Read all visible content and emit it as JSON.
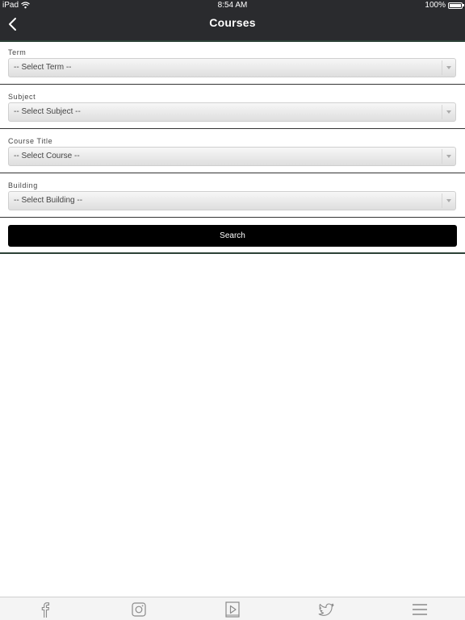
{
  "status_bar": {
    "carrier": "iPad",
    "time": "8:54 AM",
    "battery_percent": "100%"
  },
  "nav": {
    "title": "Courses",
    "back_icon": "chevron-left-icon"
  },
  "form": {
    "fields": [
      {
        "label": "Term",
        "value": "-- Select Term --"
      },
      {
        "label": "Subject",
        "value": "-- Select Subject --"
      },
      {
        "label": "Course Title",
        "value": "-- Select Course --"
      },
      {
        "label": "Building",
        "value": "-- Select Building --"
      }
    ],
    "search_label": "Search"
  },
  "tabbar": {
    "items": [
      {
        "icon": "facebook-icon"
      },
      {
        "icon": "instagram-icon"
      },
      {
        "icon": "video-play-icon"
      },
      {
        "icon": "twitter-icon"
      },
      {
        "icon": "menu-icon"
      }
    ]
  },
  "colors": {
    "header_bg": "#2a2b2e",
    "accent": "#2c4136",
    "button_bg": "#000000"
  }
}
